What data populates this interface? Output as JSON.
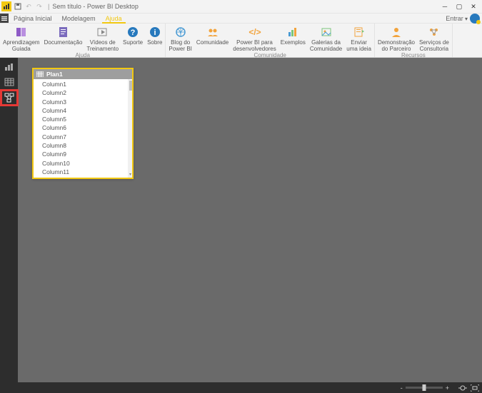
{
  "title": "Sem título - Power BI Desktop",
  "signin_label": "Entrar",
  "tabs": {
    "home": "Página Inicial",
    "modeling": "Modelagem",
    "help": "Ajuda"
  },
  "ribbon": {
    "groups": {
      "ajuda": {
        "label": "Ajuda",
        "items": {
          "guided": "Aprendizagem\nGuiada",
          "docs": "Documentação",
          "videos": "Vídeos de\nTreinamento",
          "support": "Suporte",
          "about": "Sobre"
        }
      },
      "comunidade": {
        "label": "Comunidade",
        "items": {
          "blog": "Blog do\nPower BI",
          "comm": "Comunidade",
          "devs": "Power BI para\ndesenvolvedores",
          "samples": "Exemplos",
          "galleries": "Galerias da\nComunidade",
          "idea": "Enviar\numa ideia"
        }
      },
      "recursos": {
        "label": "Recursos",
        "items": {
          "demo": "Demonstração\ndo Parceiro",
          "consult": "Serviços de\nConsultoria"
        }
      }
    }
  },
  "table_card": {
    "title": "Plan1",
    "columns": [
      "Column1",
      "Column2",
      "Column3",
      "Column4",
      "Column5",
      "Column6",
      "Column7",
      "Column8",
      "Column9",
      "Column10",
      "Column11"
    ]
  },
  "zoom": {
    "minus": "-",
    "plus": "+"
  }
}
